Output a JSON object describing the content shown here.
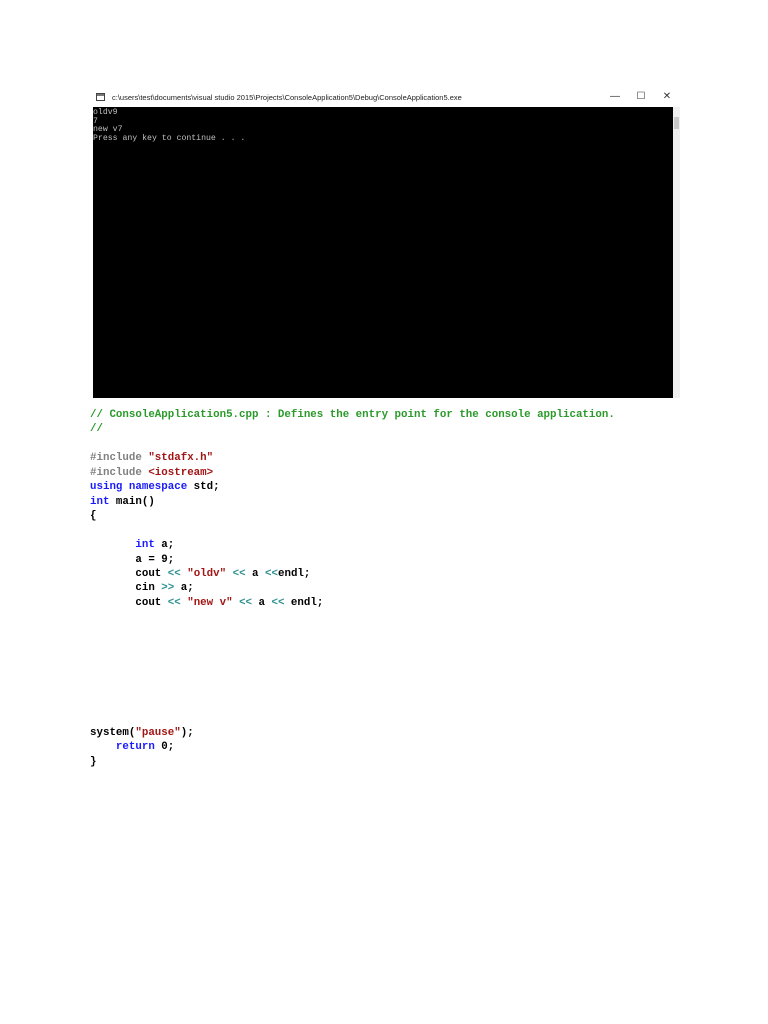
{
  "console_window": {
    "title": "c:\\users\\test\\documents\\visual studio 2015\\Projects\\ConsoleApplication5\\Debug\\ConsoleApplication5.exe",
    "minimize": "—",
    "maximize": "☐",
    "close": "✕",
    "output_lines": [
      "oldv9",
      "7",
      "new v7",
      "Press any key to continue . . ."
    ]
  },
  "code_lines": [
    [
      {
        "t": "comment",
        "v": "// ConsoleApplication5.cpp : Defines the entry point for the console application."
      }
    ],
    [
      {
        "t": "comment",
        "v": "//"
      }
    ],
    [],
    [
      {
        "t": "pre",
        "v": "#include "
      },
      {
        "t": "str",
        "v": "\"stdafx.h\""
      }
    ],
    [
      {
        "t": "pre",
        "v": "#include "
      },
      {
        "t": "str",
        "v": "<iostream>"
      }
    ],
    [
      {
        "t": "kw",
        "v": "using namespace"
      },
      {
        "t": "plain",
        "v": " std;"
      }
    ],
    [
      {
        "t": "kw",
        "v": "int"
      },
      {
        "t": "plain",
        "v": " main()"
      }
    ],
    [
      {
        "t": "plain",
        "v": "{"
      }
    ],
    [],
    [
      {
        "t": "plain",
        "v": "       "
      },
      {
        "t": "kw",
        "v": "int"
      },
      {
        "t": "plain",
        "v": " a;"
      }
    ],
    [
      {
        "t": "plain",
        "v": "       a = 9;"
      }
    ],
    [
      {
        "t": "plain",
        "v": "       cout "
      },
      {
        "t": "op",
        "v": "<<"
      },
      {
        "t": "plain",
        "v": " "
      },
      {
        "t": "str",
        "v": "\"oldv\""
      },
      {
        "t": "plain",
        "v": " "
      },
      {
        "t": "op",
        "v": "<<"
      },
      {
        "t": "plain",
        "v": " a "
      },
      {
        "t": "op",
        "v": "<<"
      },
      {
        "t": "plain",
        "v": "endl;"
      }
    ],
    [
      {
        "t": "plain",
        "v": "       cin "
      },
      {
        "t": "op",
        "v": ">>"
      },
      {
        "t": "plain",
        "v": " a;"
      }
    ],
    [
      {
        "t": "plain",
        "v": "       cout "
      },
      {
        "t": "op",
        "v": "<<"
      },
      {
        "t": "plain",
        "v": " "
      },
      {
        "t": "str",
        "v": "\"new v\""
      },
      {
        "t": "plain",
        "v": " "
      },
      {
        "t": "op",
        "v": "<<"
      },
      {
        "t": "plain",
        "v": " a "
      },
      {
        "t": "op",
        "v": "<<"
      },
      {
        "t": "plain",
        "v": " endl;"
      }
    ],
    [],
    [],
    [],
    [],
    [],
    [],
    [],
    [],
    [
      {
        "t": "plain",
        "v": "system("
      },
      {
        "t": "str",
        "v": "\"pause\""
      },
      {
        "t": "plain",
        "v": ");"
      }
    ],
    [
      {
        "t": "plain",
        "v": "    "
      },
      {
        "t": "kw",
        "v": "return"
      },
      {
        "t": "plain",
        "v": " 0;"
      }
    ],
    [
      {
        "t": "plain",
        "v": "}"
      }
    ]
  ]
}
